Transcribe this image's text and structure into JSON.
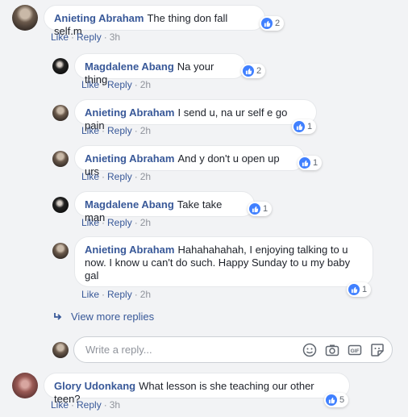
{
  "comments": [
    {
      "author": "Anieting Abraham",
      "text": "The thing don fall self.m",
      "like": "Like",
      "reply": "Reply",
      "time": "3h",
      "reactions": "2"
    },
    {
      "author": "Magdalene Abang",
      "text": "Na your thing",
      "like": "Like",
      "reply": "Reply",
      "time": "2h",
      "reactions": "2"
    },
    {
      "author": "Anieting Abraham",
      "text": "I send u, na ur self e go pain",
      "like": "Like",
      "reply": "Reply",
      "time": "2h",
      "reactions": "1"
    },
    {
      "author": "Anieting Abraham",
      "text": "And y don't u open up urs",
      "like": "Like",
      "reply": "Reply",
      "time": "2h",
      "reactions": "1"
    },
    {
      "author": "Magdalene Abang",
      "text": "Take take man",
      "like": "Like",
      "reply": "Reply",
      "time": "2h",
      "reactions": "1"
    },
    {
      "author": "Anieting Abraham",
      "text": "Hahahahahah, I enjoying talking to u now. I know u can't do such. Happy Sunday to u my baby gal",
      "like": "Like",
      "reply": "Reply",
      "time": "2h",
      "reactions": "1"
    },
    {
      "author": "Glory Udonkang",
      "text": "What lesson is she teaching our other teen?",
      "like": "Like",
      "reply": "Reply",
      "time": "3h",
      "reactions": "5"
    }
  ],
  "view_more_label": "View more replies",
  "reply_box": {
    "placeholder": "Write a reply...",
    "icons": [
      "emoji-icon",
      "camera-icon",
      "gif-icon",
      "sticker-icon"
    ]
  },
  "colors": {
    "link": "#385898",
    "meta": "#90949c",
    "like_blue": "#4080ff",
    "background": "#f2f3f5"
  }
}
